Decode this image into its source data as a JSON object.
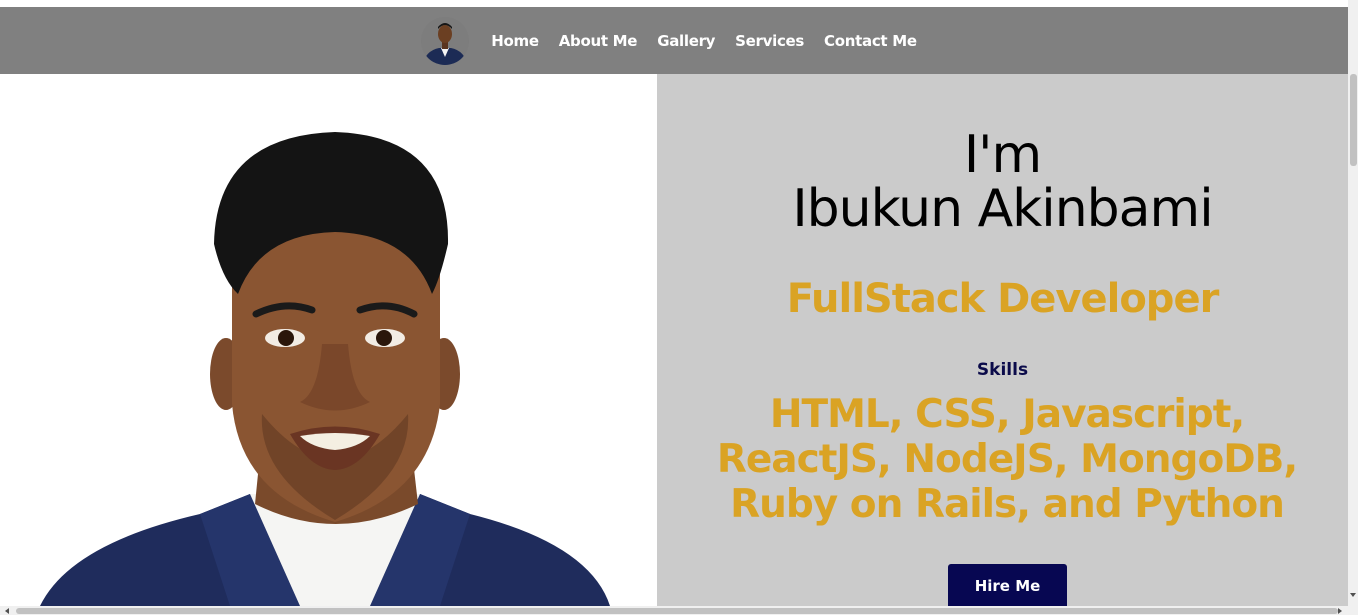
{
  "nav": {
    "avatar_icon": "profile-photo-icon",
    "links": [
      "Home",
      "About Me",
      "Gallery",
      "Services",
      "Contact Me"
    ]
  },
  "hero": {
    "intro_line1": "I'm",
    "intro_line2": "Ibukun Akinbami",
    "role": "FullStack Developer",
    "skills_label": "Skills",
    "skills_list": "HTML, CSS, Javascript, ReactJS, NodeJS, MongoDB, Ruby on Rails, and Python",
    "cta_label": "Hire Me",
    "photo_icon": "portrait-photo-icon"
  },
  "colors": {
    "navbar": "#808080",
    "accent": "#daa324",
    "button": "#070752",
    "panel": "#cbcbcb"
  }
}
